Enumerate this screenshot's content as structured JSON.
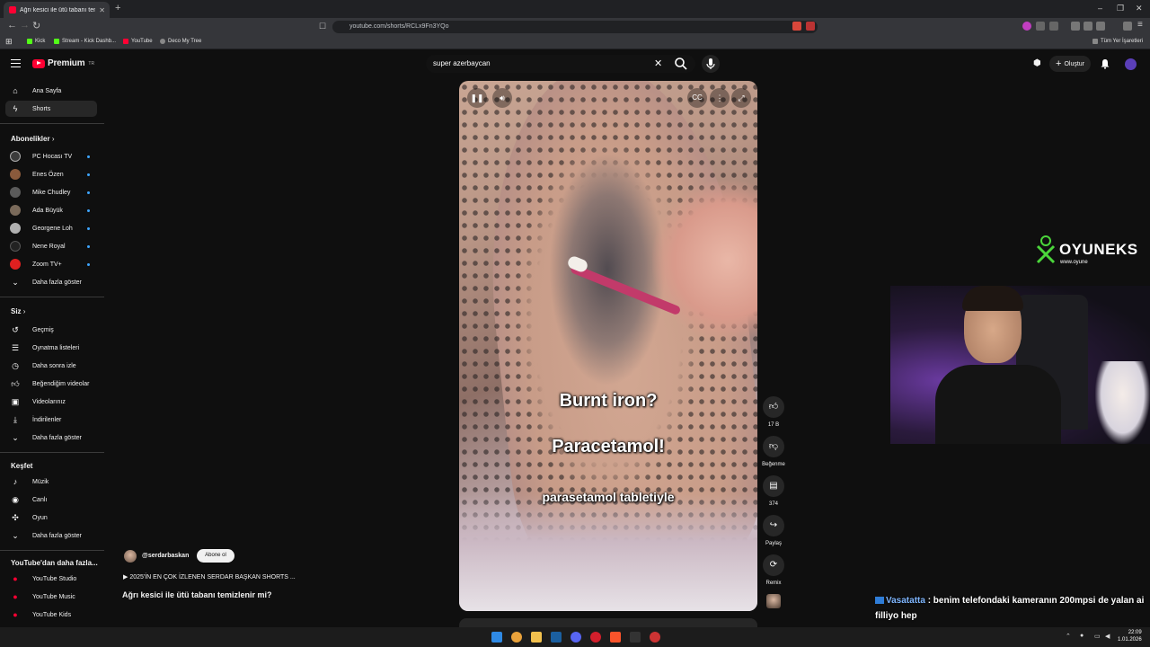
{
  "browser": {
    "tab_title": "Ağrı kesici ile ütü tabanı tem",
    "url": "youtube.com/shorts/RCLx9Fn3YQo",
    "bookmarks": [
      "Kick",
      "Stream - Kick Dashb...",
      "YouTube",
      "Deco My Tree"
    ],
    "all_bookmarks": "Tüm Yer İşaretleri"
  },
  "header": {
    "logo": "Premium",
    "logo_sup": "TR",
    "search_value": "super azerbaycan",
    "create_label": "Oluştur"
  },
  "sidebar": {
    "main": [
      {
        "label": "Ana Sayfa",
        "icon": "home-icon"
      },
      {
        "label": "Shorts",
        "icon": "shorts-icon"
      }
    ],
    "subs_heading": "Abonelikler",
    "subs": [
      {
        "label": "PC Hocası TV",
        "color": "#3b3b3b"
      },
      {
        "label": "Enes Özen",
        "color": "#8a5a3c"
      },
      {
        "label": "Mike Chudley",
        "color": "#5b5b5b"
      },
      {
        "label": "Ada Büyük",
        "color": "#7a6a5a"
      },
      {
        "label": "Georgene Loh",
        "color": "#b0b0b0"
      },
      {
        "label": "Nene Royal",
        "color": "#222222"
      },
      {
        "label": "Zoom TV+",
        "color": "#e02020"
      }
    ],
    "show_more": "Daha fazla göster",
    "you_heading": "Siz",
    "you": [
      {
        "label": "Geçmiş",
        "icon": "history-icon"
      },
      {
        "label": "Oynatma listeleri",
        "icon": "playlist-icon"
      },
      {
        "label": "Daha sonra izle",
        "icon": "clock-icon"
      },
      {
        "label": "Beğendiğim videolar",
        "icon": "like-icon"
      },
      {
        "label": "Videolarınız",
        "icon": "video-icon"
      },
      {
        "label": "İndirilenler",
        "icon": "download-icon"
      }
    ],
    "explore_heading": "Keşfet",
    "explore": [
      {
        "label": "Müzik",
        "icon": "music-icon"
      },
      {
        "label": "Canlı",
        "icon": "live-icon"
      },
      {
        "label": "Oyun",
        "icon": "game-icon"
      }
    ],
    "more_heading": "YouTube'dan daha fazla...",
    "more": [
      {
        "label": "YouTube Studio"
      },
      {
        "label": "YouTube Music"
      },
      {
        "label": "YouTube Kids"
      }
    ]
  },
  "short": {
    "caption1": "Burnt iron?",
    "caption2": "Paracetamol!",
    "caption3": "parasetamol tabletiyle",
    "likes": "17 B",
    "dislike_label": "Beğenme",
    "comments": "374",
    "share_label": "Paylaş",
    "remix_label": "Remix",
    "channel": "@serdarbaskan",
    "subscribe": "Abone ol",
    "playlist": "2025'İN EN ÇOK İZLENEN SERDAR BAŞKAN SHORTS ...",
    "title": "Ağrı kesici ile ütü tabanı temizlenir mi?"
  },
  "overlay": {
    "brand": "OYUNEKS",
    "brand_sub": "www.oyune",
    "chat_user": "Vasatatta",
    "chat_msg": ": benim telefondaki kameranın 200mpsi de yalan ai filliyo hep"
  },
  "taskbar": {
    "time": "22:09",
    "date": "1.01.2026"
  }
}
